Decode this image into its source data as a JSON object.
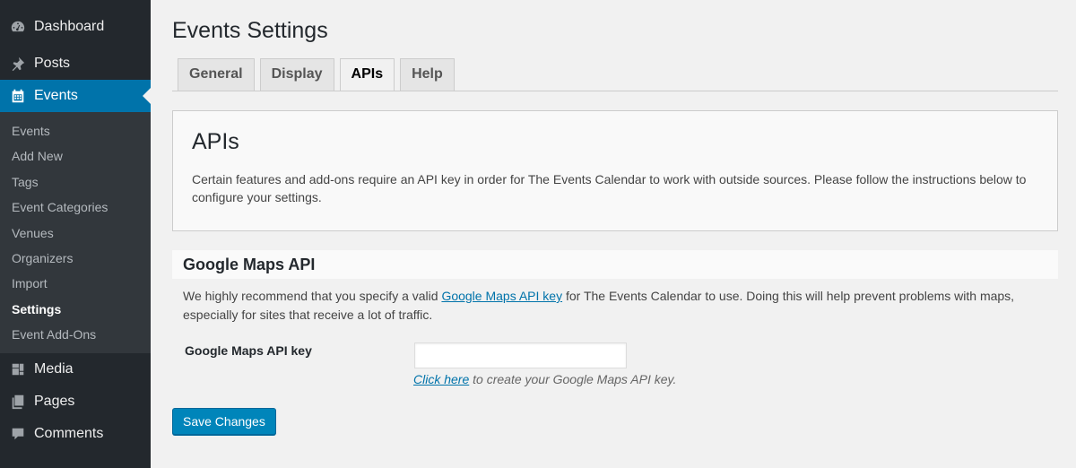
{
  "sidebar": {
    "top_items": [
      {
        "label": "Dashboard",
        "icon": "dashboard-icon"
      },
      {
        "label": "Posts",
        "icon": "pin-icon"
      },
      {
        "label": "Events",
        "icon": "calendar-icon"
      }
    ],
    "submenu": [
      "Events",
      "Add New",
      "Tags",
      "Event Categories",
      "Venues",
      "Organizers",
      "Import",
      "Settings",
      "Event Add-Ons"
    ],
    "active_submenu": "Settings",
    "bottom_items": [
      {
        "label": "Media",
        "icon": "media-icon"
      },
      {
        "label": "Pages",
        "icon": "pages-icon"
      },
      {
        "label": "Comments",
        "icon": "comments-icon"
      }
    ],
    "colors": {
      "background": "#23282d",
      "active": "#0073aa"
    }
  },
  "main": {
    "page_title": "Events Settings",
    "tabs": [
      {
        "label": "General"
      },
      {
        "label": "Display"
      },
      {
        "label": "APIs"
      },
      {
        "label": "Help"
      }
    ],
    "active_tab": "APIs",
    "intro": {
      "heading": "APIs",
      "text": "Certain features and add-ons require an API key in order for The Events Calendar to work with outside sources. Please follow the instructions below to configure your settings."
    },
    "google_maps": {
      "title": "Google Maps API",
      "desc_before": "We highly recommend that you specify a valid ",
      "desc_link": "Google Maps API key",
      "desc_after": " for The Events Calendar to use. Doing this will help prevent problems with maps, especially for sites that receive a lot of traffic.",
      "field_label": "Google Maps API key",
      "field_value": "",
      "helper_link": "Click here",
      "helper_text": " to create your Google Maps API key."
    },
    "save_button": "Save Changes"
  }
}
